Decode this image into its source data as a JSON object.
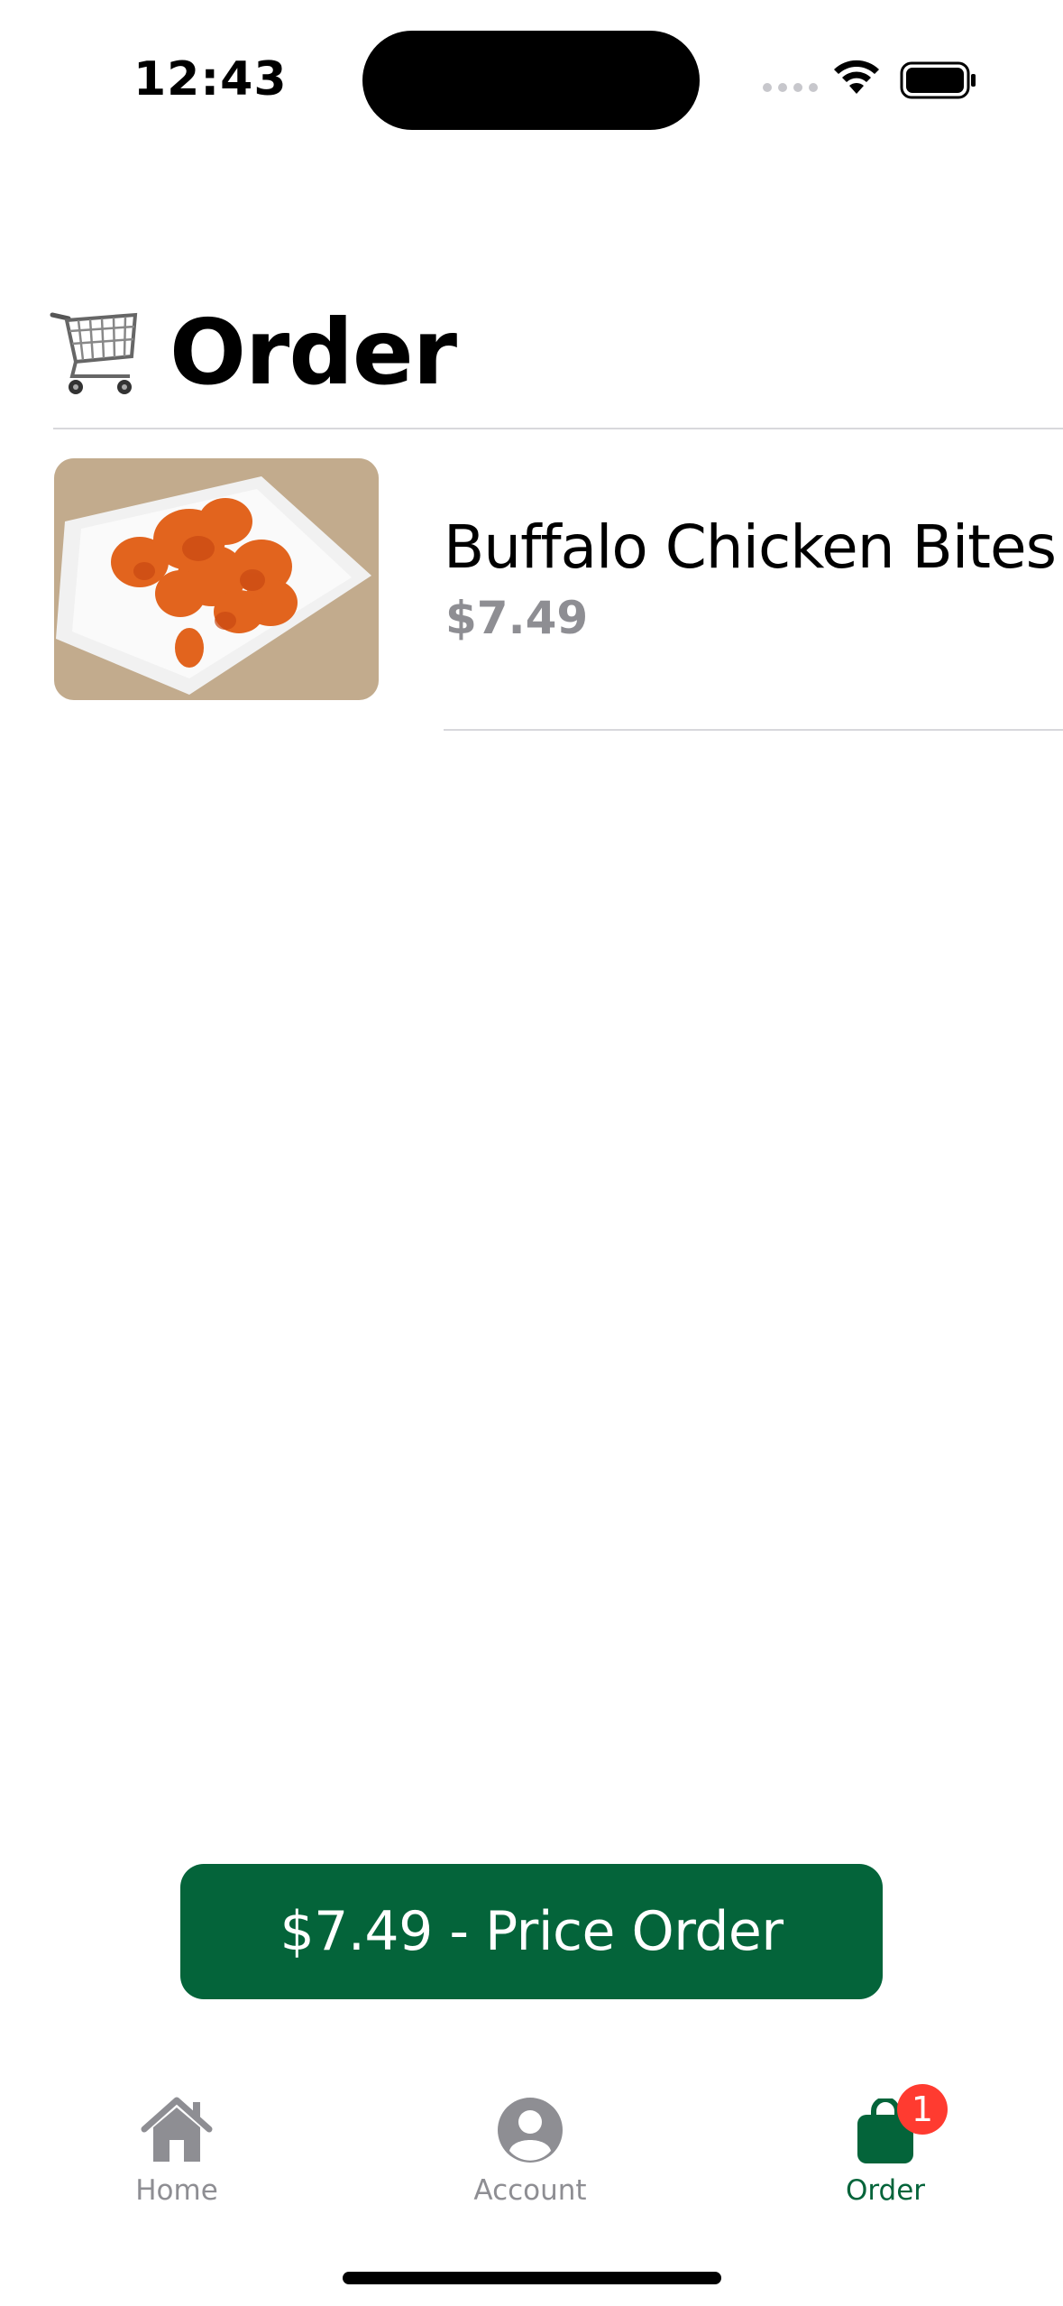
{
  "status_bar": {
    "time": "12:43"
  },
  "header": {
    "title": "Order",
    "icon": "shopping-cart-icon"
  },
  "order_items": [
    {
      "name": "Buffalo Chicken Bites",
      "price": "$7.49",
      "image": "buffalo-chicken-bites-photo"
    }
  ],
  "primary_action": {
    "label": "$7.49 - Price Order"
  },
  "tab_bar": {
    "tabs": [
      {
        "label": "Home",
        "icon": "house-icon",
        "active": false
      },
      {
        "label": "Account",
        "icon": "person-circle-icon",
        "active": false
      },
      {
        "label": "Order",
        "icon": "shopping-bag-icon",
        "active": true,
        "badge": "1"
      }
    ]
  },
  "colors": {
    "accent": "#04643a",
    "badge": "#ff3b30",
    "secondary_text": "#8e8e93"
  }
}
